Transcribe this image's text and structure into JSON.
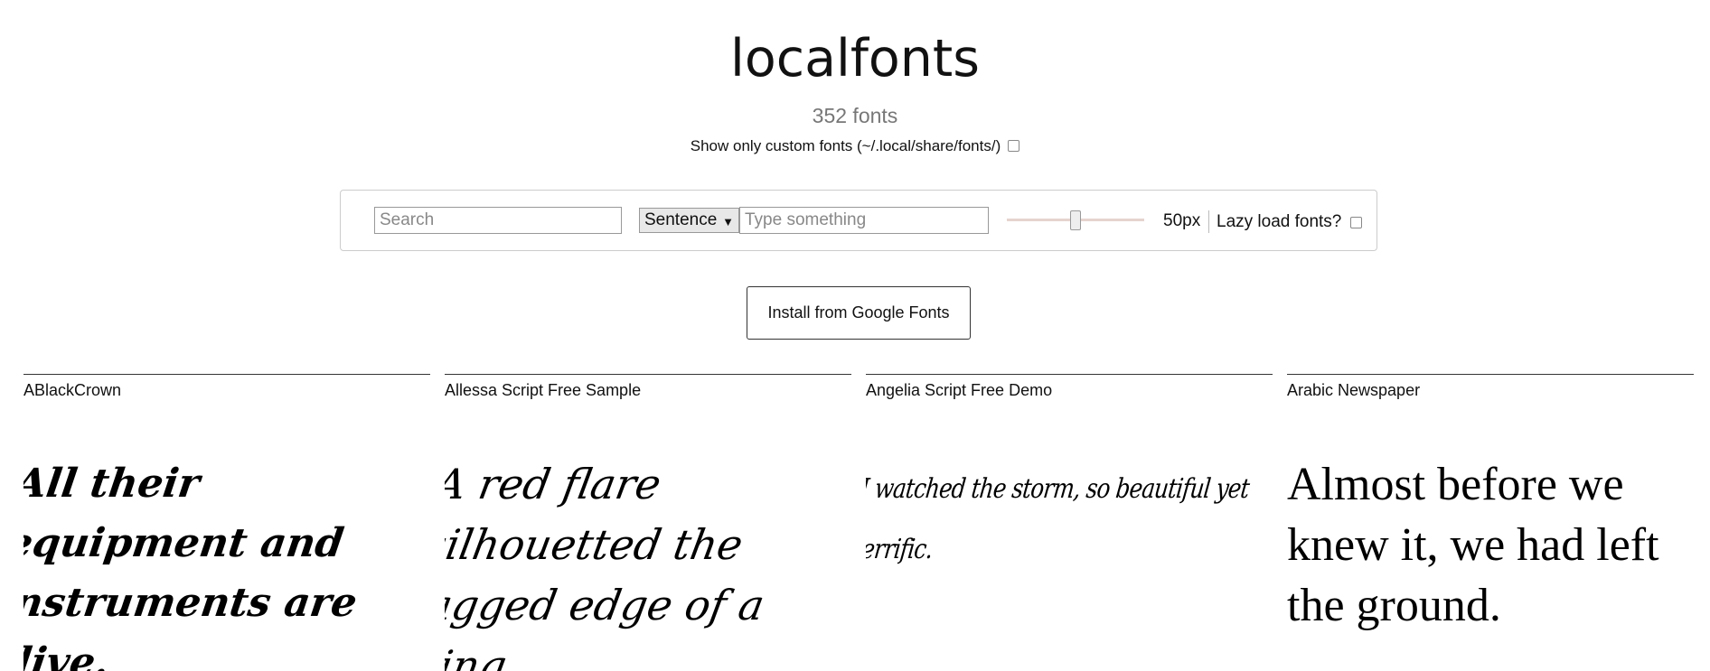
{
  "header": {
    "title": "localfonts",
    "font_count": "352 fonts",
    "custom_only_label": "Show only custom fonts (~/.local/share/fonts/)"
  },
  "controls": {
    "search_placeholder": "Search",
    "mode_selected": "Sentence",
    "text_placeholder": "Type something",
    "size_value": "50px",
    "lazy_load_label": "Lazy load fonts?"
  },
  "install_button_label": "Install from Google Fonts",
  "fonts": [
    {
      "name": "ABlackCrown",
      "sample": "All their equipment and instruments are alive."
    },
    {
      "name": "Allessa Script Free Sample",
      "sample": "A red flare silhouetted the jagged edge of a wing."
    },
    {
      "name": "Angelia Script Free Demo",
      "sample": "I watched the storm, so beautiful yet terrific."
    },
    {
      "name": "Arabic Newspaper",
      "sample": "Almost before we knew it, we had left the ground."
    }
  ]
}
